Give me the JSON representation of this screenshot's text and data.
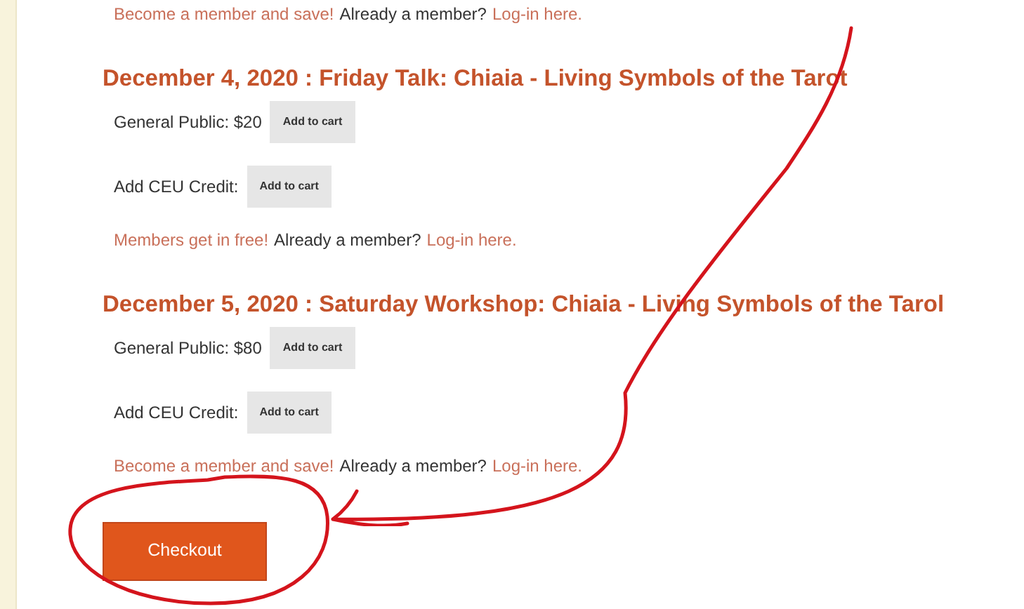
{
  "top_note": {
    "link": "Become a member and save!",
    "text": "Already a member?",
    "login": "Log-in here."
  },
  "events": [
    {
      "title": "December 4, 2020 : Friday Talk: Chiaia - Living Symbols of the Tarot",
      "rows": [
        {
          "label": "General Public: $20",
          "button": "Add to cart"
        },
        {
          "label": "Add CEU Credit:",
          "button": "Add to cart"
        }
      ],
      "note": {
        "link": "Members get in free!",
        "text": "Already a member?",
        "login": "Log-in here."
      }
    },
    {
      "title": "December 5, 2020 : Saturday Workshop: Chiaia - Living Symbols of the Tarol",
      "rows": [
        {
          "label": "General Public: $80",
          "button": "Add to cart"
        },
        {
          "label": "Add CEU Credit:",
          "button": "Add to cart"
        }
      ],
      "note": {
        "link": "Become a member and save!",
        "text": "Already a member?",
        "login": "Log-in here."
      }
    }
  ],
  "checkout": "Checkout"
}
